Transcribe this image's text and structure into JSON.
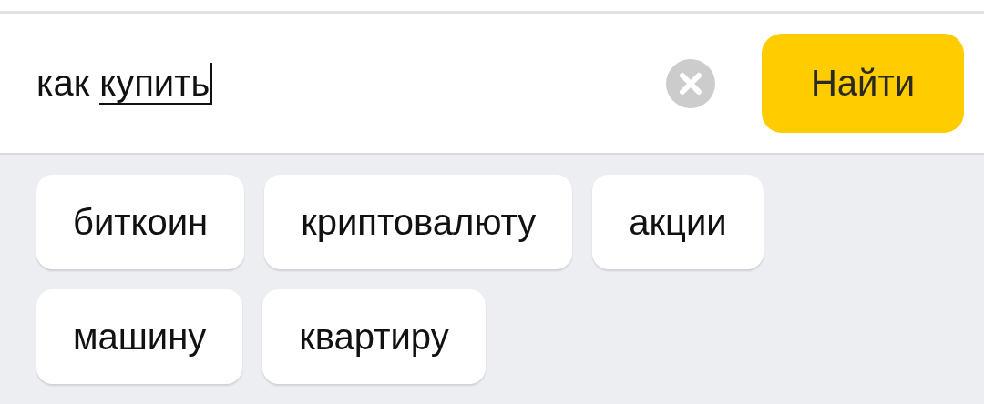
{
  "search": {
    "query": "как",
    "composing": "купить",
    "button": "Найти"
  },
  "suggestions": [
    "биткоин",
    "криптовалюту",
    "акции",
    "машину",
    "квартиру"
  ]
}
